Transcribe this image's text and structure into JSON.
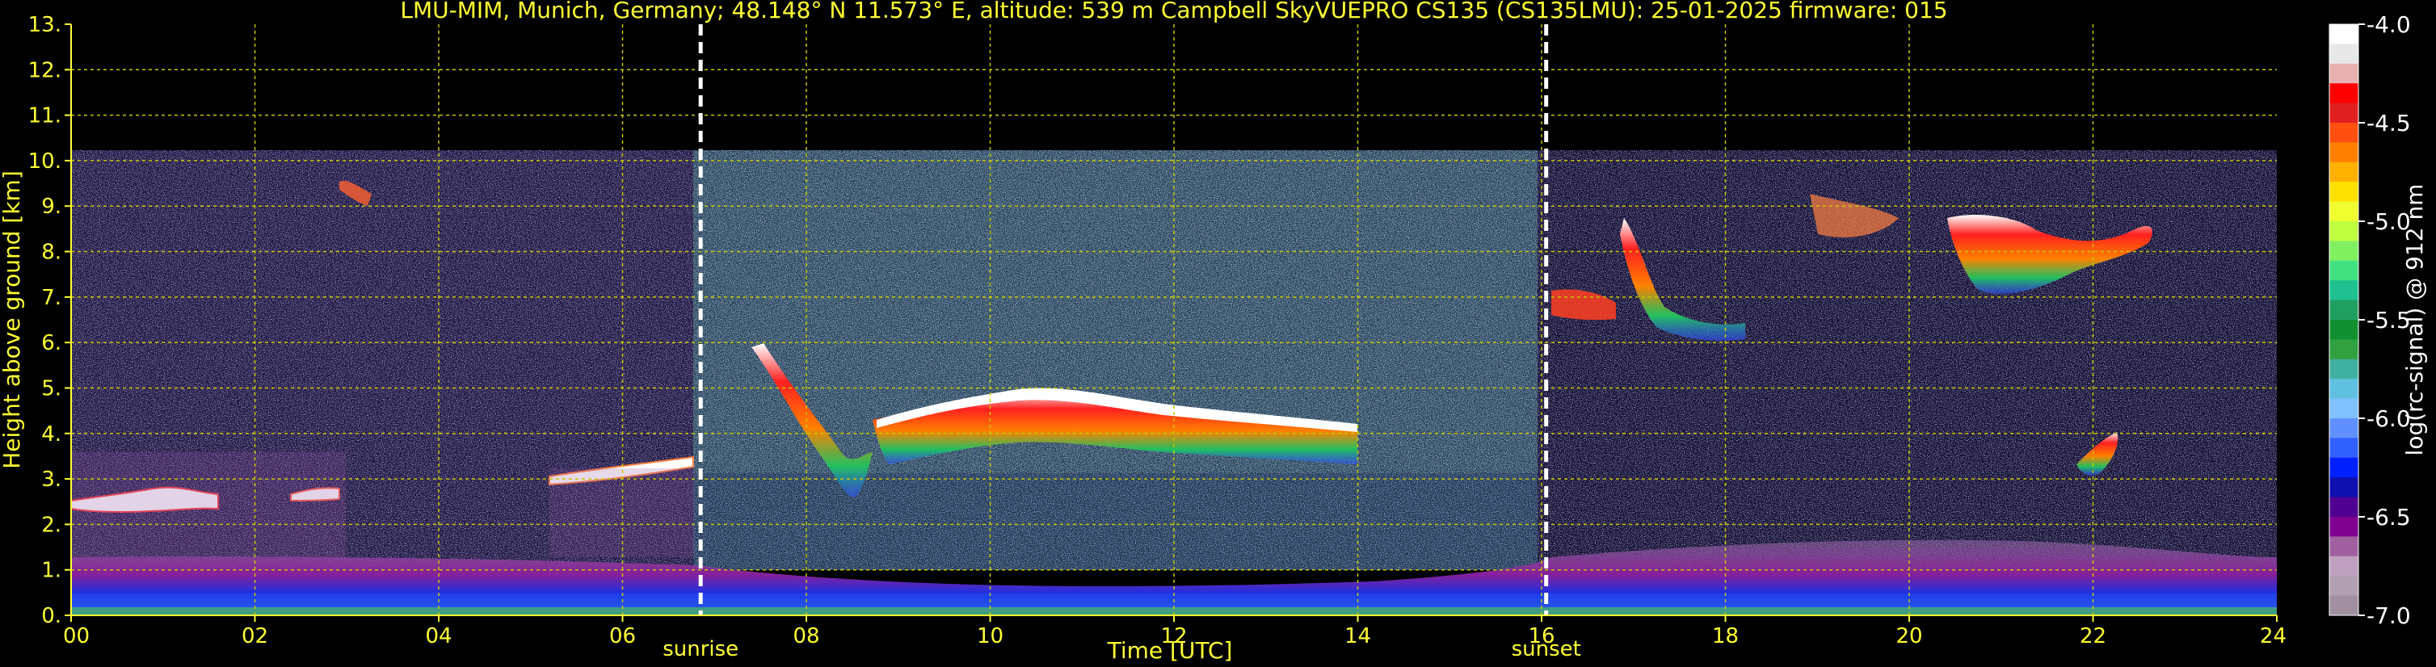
{
  "title": "LMU-MIM, Munich, Germany; 48.148° N 11.573° E, altitude: 539 m    Campbell SkyVUEPRO CS135 (CS135LMU): 25-01-2025    firmware: 015",
  "chart_data": {
    "type": "heatmap",
    "xlabel": "Time [UTC]",
    "ylabel": "Height above ground [km]",
    "xlim": [
      0,
      24
    ],
    "ylim": [
      0,
      13
    ],
    "x_ticks": [
      "00",
      "02",
      "04",
      "06",
      "08",
      "10",
      "12",
      "14",
      "16",
      "18",
      "20",
      "22",
      "24"
    ],
    "y_ticks": [
      "0.",
      "1.",
      "2.",
      "3.",
      "4.",
      "5.",
      "6.",
      "7.",
      "8.",
      "9.",
      "10.",
      "11.",
      "12.",
      "13."
    ],
    "grid": true,
    "markers": [
      {
        "label": "sunrise",
        "x": 6.85
      },
      {
        "label": "sunset",
        "x": 16.05
      }
    ],
    "colorbar": {
      "label": "log(rc-signal) @ 912 nm",
      "range": [
        -7.0,
        -4.0
      ],
      "ticks": [
        "-4.0",
        "-4.5",
        "-5.0",
        "-5.5",
        "-6.0",
        "-6.5",
        "-7.0"
      ],
      "colors": [
        "#ffffff",
        "#e8e8e8",
        "#e8b0b0",
        "#ff0000",
        "#e02020",
        "#ff5010",
        "#ff8000",
        "#ffb000",
        "#ffe000",
        "#f0ff30",
        "#c0ff40",
        "#80f060",
        "#40e080",
        "#20c090",
        "#20a060",
        "#109030",
        "#30a040",
        "#40b0a0",
        "#60c0e0",
        "#80c0ff",
        "#6090ff",
        "#3060ff",
        "#0020ff",
        "#1010b0",
        "#500090",
        "#800090",
        "#a060a0",
        "#c0a0c0",
        "#b0a0b0",
        "#a090a0"
      ]
    },
    "features": [
      {
        "name": "boundary layer",
        "x": [
          0,
          24
        ],
        "y": [
          0,
          1.2
        ]
      },
      {
        "name": "noise region",
        "x": [
          0,
          24
        ],
        "y": [
          1.2,
          10.3
        ]
      },
      {
        "name": "low cloud",
        "x": [
          0,
          6.8
        ],
        "y_approx": [
          2.5,
          3.3
        ]
      },
      {
        "name": "cloud layer",
        "x": [
          7.3,
          13.9
        ],
        "y_approx": [
          2.5,
          6
        ]
      },
      {
        "name": "mid-level cloud",
        "x": [
          16.5,
          22.7
        ],
        "y_approx": [
          6,
          9.2
        ]
      },
      {
        "name": "isolated cloud",
        "x": [
          21.4,
          21.9
        ],
        "y_approx": [
          3.2,
          4
        ]
      }
    ]
  }
}
